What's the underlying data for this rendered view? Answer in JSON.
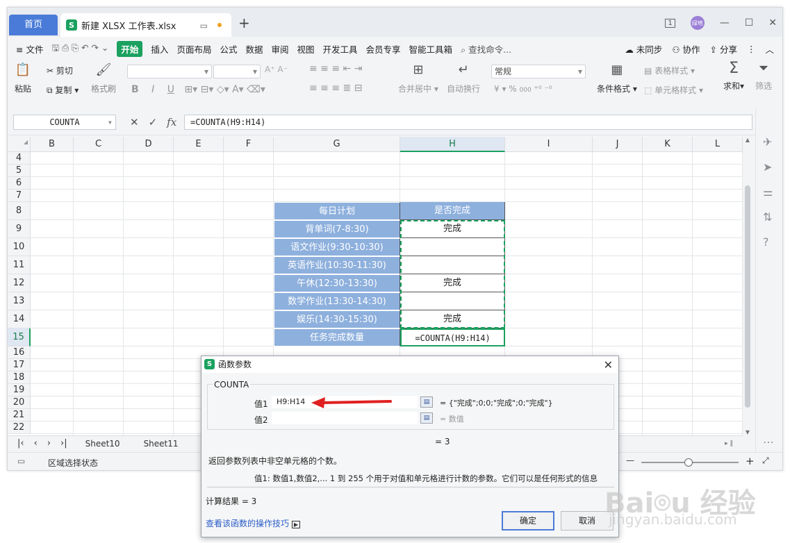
{
  "tabs": {
    "home": "首页",
    "doc": "新建 XLSX 工作表.xlsx",
    "badge": "S",
    "new_tab": "+"
  },
  "window": {
    "avatar": "绿地",
    "monitor": "1"
  },
  "menu": {
    "items": [
      "≡ 文件",
      "开始",
      "插入",
      "页面布局",
      "公式",
      "数据",
      "审阅",
      "视图",
      "开发工具",
      "会员专享",
      "智能工具箱"
    ],
    "search": "查找命令...",
    "right": [
      "未同步",
      "协作",
      "分享"
    ]
  },
  "ribbon": {
    "paste": "粘贴",
    "cut": "剪切",
    "copy": "复制",
    "format_painter": "格式刷",
    "merge": "合并居中",
    "wrap": "自动换行",
    "number_format": "常规",
    "conditional": "条件格式",
    "table_style": "表格样式",
    "cell_style": "单元格样式",
    "sum": "求和",
    "filter": "筛选",
    "bold": "B",
    "italic": "I",
    "underline": "U",
    "percent": "%",
    "thousands": "000"
  },
  "formula_bar": {
    "name_box": "COUNTA",
    "fx": "fx",
    "formula": "=COUNTA(H9:H14)"
  },
  "grid": {
    "columns": [
      "B",
      "C",
      "D",
      "E",
      "F",
      "G",
      "H",
      "I",
      "J",
      "K",
      "L"
    ],
    "rows": [
      "4",
      "5",
      "6",
      "7",
      "8",
      "9",
      "10",
      "11",
      "12",
      "13",
      "14",
      "15",
      "16",
      "17",
      "18",
      "19",
      "20",
      "21",
      "22"
    ],
    "table": {
      "header_g": "每日计划",
      "header_h": "是否完成",
      "rows": [
        {
          "plan": "背单词(7-8:30)",
          "done": "完成"
        },
        {
          "plan": "语文作业(9:30-10:30)",
          "done": ""
        },
        {
          "plan": "英语作业(10:30-11:30)",
          "done": ""
        },
        {
          "plan": "午休(12:30-13:30)",
          "done": "完成"
        },
        {
          "plan": "数学作业(13:30-14:30)",
          "done": ""
        },
        {
          "plan": "娱乐(14:30-15:30)",
          "done": "完成"
        }
      ],
      "total_label": "任务完成数量",
      "total_formula": "=COUNTA(H9:H14)"
    }
  },
  "sheets": [
    "Sheet10",
    "Sheet11"
  ],
  "status": {
    "mode": "区域选择状态"
  },
  "dialog": {
    "title": "函数参数",
    "function_name": "COUNTA",
    "arg1_label": "值1",
    "arg1_value": "H9:H14",
    "arg1_result": "= {\"完成\";0;0;\"完成\";0;\"完成\"}",
    "arg2_label": "值2",
    "arg2_result": "= 数值",
    "result_line": "= 3",
    "description": "返回参数列表中非空单元格的个数。",
    "arg_help": "值1:  数值1,数值2,... 1 到 255 个用于对值和单元格进行计数的参数。它们可以是任何形式的信息",
    "calc_result": "计算结果 = 3",
    "tips_link": "查看该函数的操作技巧",
    "ok": "确定",
    "cancel": "取消",
    "accent": "#e02020"
  },
  "watermark": {
    "brand": "Baidu 经验",
    "url": "jingyan.baidu.com"
  }
}
